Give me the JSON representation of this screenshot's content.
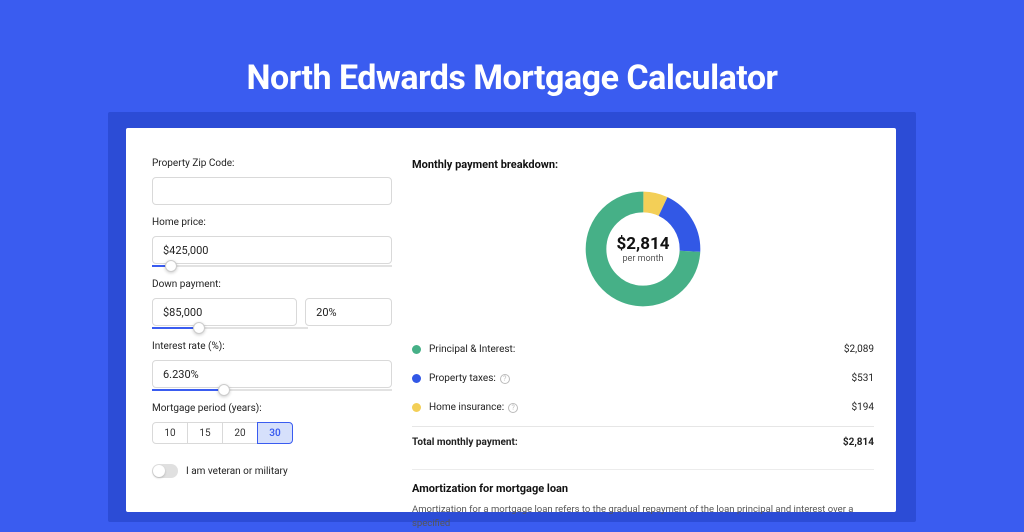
{
  "title": "North Edwards Mortgage Calculator",
  "form": {
    "zip": {
      "label": "Property Zip Code:",
      "value": ""
    },
    "home_price": {
      "label": "Home price:",
      "value": "$425,000",
      "slider_pct": 8
    },
    "down_payment": {
      "label": "Down payment:",
      "amount": "$85,000",
      "percent": "20%",
      "slider_pct": 20
    },
    "interest_rate": {
      "label": "Interest rate (%):",
      "value": "6.230%",
      "slider_pct": 30
    },
    "period": {
      "label": "Mortgage period (years):",
      "options": [
        "10",
        "15",
        "20",
        "30"
      ],
      "selected": "30"
    },
    "veteran": {
      "label": "I am veteran or military",
      "checked": false
    }
  },
  "breakdown": {
    "title": "Monthly payment breakdown:",
    "center_amount": "$2,814",
    "center_sub": "per month",
    "items": [
      {
        "label": "Principal & Interest:",
        "value": "$2,089",
        "color": "#46b087",
        "info": false
      },
      {
        "label": "Property taxes:",
        "value": "$531",
        "color": "#3258e6",
        "info": true
      },
      {
        "label": "Home insurance:",
        "value": "$194",
        "color": "#f3cf57",
        "info": true
      }
    ],
    "total_label": "Total monthly payment:",
    "total_value": "$2,814"
  },
  "amortization": {
    "title": "Amortization for mortgage loan",
    "body": "Amortization for a mortgage loan refers to the gradual repayment of the loan principal and interest over a specified"
  },
  "chart_data": {
    "type": "pie",
    "title": "Monthly payment breakdown",
    "series": [
      {
        "name": "Principal & Interest",
        "value": 2089,
        "color": "#46b087"
      },
      {
        "name": "Property taxes",
        "value": 531,
        "color": "#3258e6"
      },
      {
        "name": "Home insurance",
        "value": 194,
        "color": "#f3cf57"
      }
    ],
    "total": 2814,
    "center_label": "$2,814 per month"
  }
}
